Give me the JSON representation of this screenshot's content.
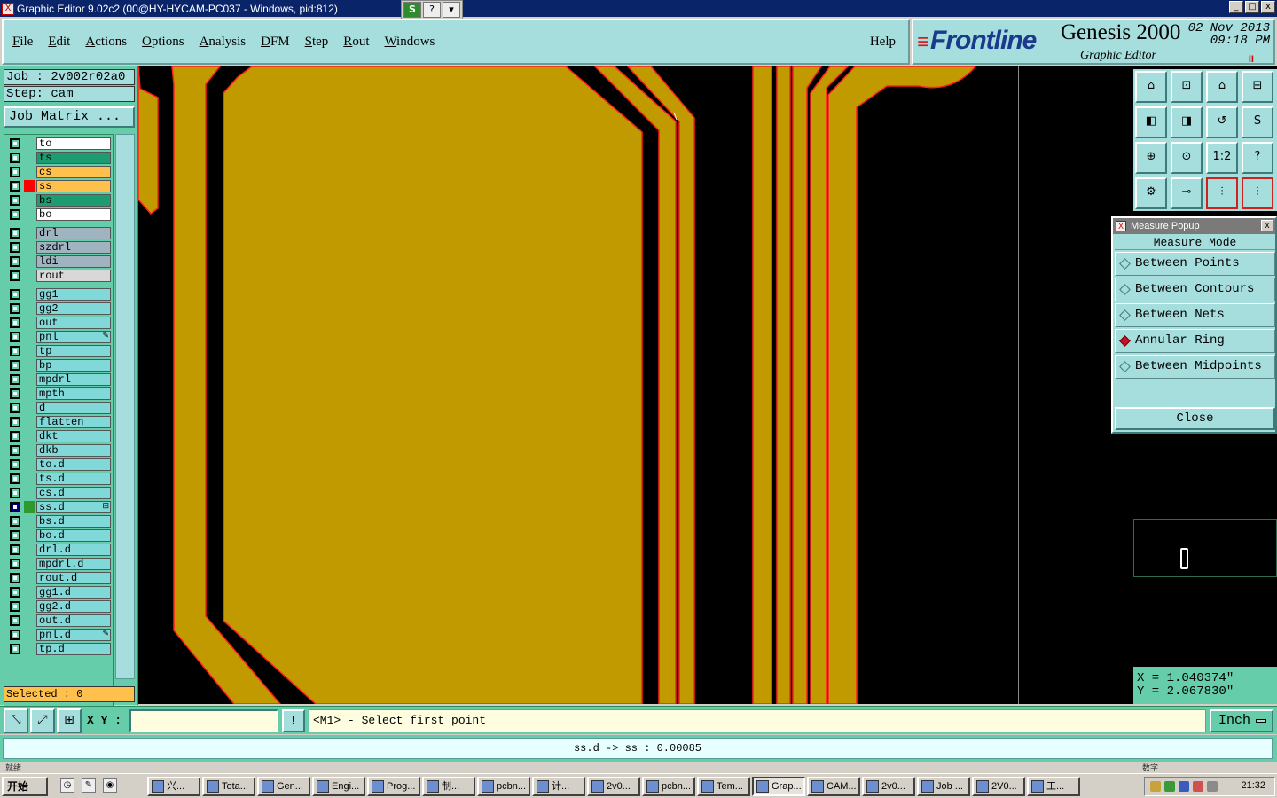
{
  "window": {
    "title": "Graphic Editor 9.02c2 (00@HY-HYCAM-PC037 - Windows, pid:812)",
    "title_icon": "X",
    "tools": [
      "S",
      "?",
      "▾"
    ],
    "controls": [
      "_",
      "□",
      "x"
    ]
  },
  "menu": {
    "items": [
      "File",
      "Edit",
      "Actions",
      "Options",
      "Analysis",
      "DFM",
      "Step",
      "Rout",
      "Windows"
    ],
    "help": "Help"
  },
  "brand": {
    "logo": "Frontline",
    "logo_mark": "≡",
    "product": "Genesis 2000",
    "subtitle": "Graphic Editor",
    "date": "02 Nov 2013",
    "time": "09:18 PM",
    "pause_glyph": "II"
  },
  "job": {
    "job_label": "Job : 2v002r02a0",
    "step_label": "Step: cam",
    "matrix_button": "Job Matrix ..."
  },
  "layers": [
    {
      "name": "to",
      "color": "#ffffff",
      "mark": ""
    },
    {
      "name": "ts",
      "color": "#1c9c70",
      "mark": ""
    },
    {
      "name": "cs",
      "color": "#ffc04c",
      "mark": ""
    },
    {
      "name": "ss",
      "color": "#ffc04c",
      "mark": "#ff0000"
    },
    {
      "name": "bs",
      "color": "#1c9c70",
      "mark": ""
    },
    {
      "name": "bo",
      "color": "#ffffff",
      "mark": ""
    },
    {
      "name": "drl",
      "color": "#a0b4c0",
      "mark": ""
    },
    {
      "name": "szdrl",
      "color": "#a0b4c0",
      "mark": ""
    },
    {
      "name": "ldi",
      "color": "#a0b4c0",
      "mark": ""
    },
    {
      "name": "rout",
      "color": "#d8d8d8",
      "mark": ""
    },
    {
      "name": "gg1",
      "color": "#80d8d8",
      "mark": ""
    },
    {
      "name": "gg2",
      "color": "#80d8d8",
      "mark": ""
    },
    {
      "name": "out",
      "color": "#80d8d8",
      "mark": ""
    },
    {
      "name": "pnl",
      "color": "#80d8d8",
      "mark": "",
      "flag": "✎"
    },
    {
      "name": "tp",
      "color": "#80d8d8",
      "mark": ""
    },
    {
      "name": "bp",
      "color": "#80d8d8",
      "mark": ""
    },
    {
      "name": "mpdrl",
      "color": "#80d8d8",
      "mark": ""
    },
    {
      "name": "mpth",
      "color": "#80d8d8",
      "mark": ""
    },
    {
      "name": "d",
      "color": "#80d8d8",
      "mark": ""
    },
    {
      "name": "flatten",
      "color": "#80d8d8",
      "mark": ""
    },
    {
      "name": "dkt",
      "color": "#80d8d8",
      "mark": ""
    },
    {
      "name": "dkb",
      "color": "#80d8d8",
      "mark": ""
    },
    {
      "name": "to.d",
      "color": "#80d8d8",
      "mark": ""
    },
    {
      "name": "ts.d",
      "color": "#80d8d8",
      "mark": ""
    },
    {
      "name": "cs.d",
      "color": "#80d8d8",
      "mark": ""
    },
    {
      "name": "ss.d",
      "color": "#80d8d8",
      "mark": "#2e9a2e",
      "active": true,
      "flag": "⊞"
    },
    {
      "name": "bs.d",
      "color": "#80d8d8",
      "mark": ""
    },
    {
      "name": "bo.d",
      "color": "#80d8d8",
      "mark": ""
    },
    {
      "name": "drl.d",
      "color": "#80d8d8",
      "mark": ""
    },
    {
      "name": "mpdrl.d",
      "color": "#80d8d8",
      "mark": ""
    },
    {
      "name": "rout.d",
      "color": "#80d8d8",
      "mark": ""
    },
    {
      "name": "gg1.d",
      "color": "#80d8d8",
      "mark": ""
    },
    {
      "name": "gg2.d",
      "color": "#80d8d8",
      "mark": ""
    },
    {
      "name": "out.d",
      "color": "#80d8d8",
      "mark": ""
    },
    {
      "name": "pnl.d",
      "color": "#80d8d8",
      "mark": "",
      "flag": "✎"
    },
    {
      "name": "tp.d",
      "color": "#80d8d8",
      "mark": ""
    }
  ],
  "selected": "Selected : 0",
  "toolbar_icons": [
    {
      "name": "zoom-home-icon",
      "glyph": "⌂"
    },
    {
      "name": "zoom-in-icon",
      "glyph": "⊡"
    },
    {
      "name": "home-icon",
      "glyph": "⌂"
    },
    {
      "name": "split-view-icon",
      "glyph": "⊟"
    },
    {
      "name": "pan-left-icon",
      "glyph": "◧"
    },
    {
      "name": "pan-right-icon",
      "glyph": "◨"
    },
    {
      "name": "undo-view-icon",
      "glyph": "↺"
    },
    {
      "name": "redraw-icon",
      "glyph": "S"
    },
    {
      "name": "zoom-fit-icon",
      "glyph": "⊕"
    },
    {
      "name": "zoom-center-icon",
      "glyph": "⊙"
    },
    {
      "name": "scale-1-2-icon",
      "glyph": "1:2"
    },
    {
      "name": "query-icon",
      "glyph": "?"
    },
    {
      "name": "settings-tools-icon",
      "glyph": "⚙"
    },
    {
      "name": "snap-icon",
      "glyph": "⊸"
    },
    {
      "name": "layer-compare-a-icon",
      "glyph": "⫶"
    },
    {
      "name": "layer-compare-b-icon",
      "glyph": "⫶"
    }
  ],
  "measure_popup": {
    "title": "Measure Popup",
    "mode_label": "Measure Mode",
    "options": [
      "Between Points",
      "Between Contours",
      "Between Nets",
      "Annular Ring",
      "Between Midpoints"
    ],
    "selected_index": 3,
    "close_label": "Close"
  },
  "coords": {
    "x": "X = 1.040374\"",
    "y": "Y = 2.067830\""
  },
  "command": {
    "xy_label": "X Y :",
    "xy_value": "",
    "bang": "!",
    "prompt": "<M1> - Select first point",
    "unit": "Inch"
  },
  "status": "ss.d -> ss : 0.00085",
  "strip": {
    "left": "就绪",
    "right": "数字"
  },
  "taskbar": {
    "start": "开始",
    "tasks": [
      "兴...",
      "Tota...",
      "Gen...",
      "Engi...",
      "Prog...",
      "制...",
      "pcbn...",
      "计...",
      "2v0...",
      "pcbn...",
      "Tem...",
      "Grap...",
      "CAM...",
      "2v0...",
      "Job ...",
      "2V0...",
      "工..."
    ],
    "active_index": 11,
    "clock": "21:32"
  },
  "colors": {
    "copper": "#c19a00",
    "outline": "#ff2020",
    "background": "#000000",
    "panel": "#66cdaa",
    "button": "#a6dede"
  }
}
